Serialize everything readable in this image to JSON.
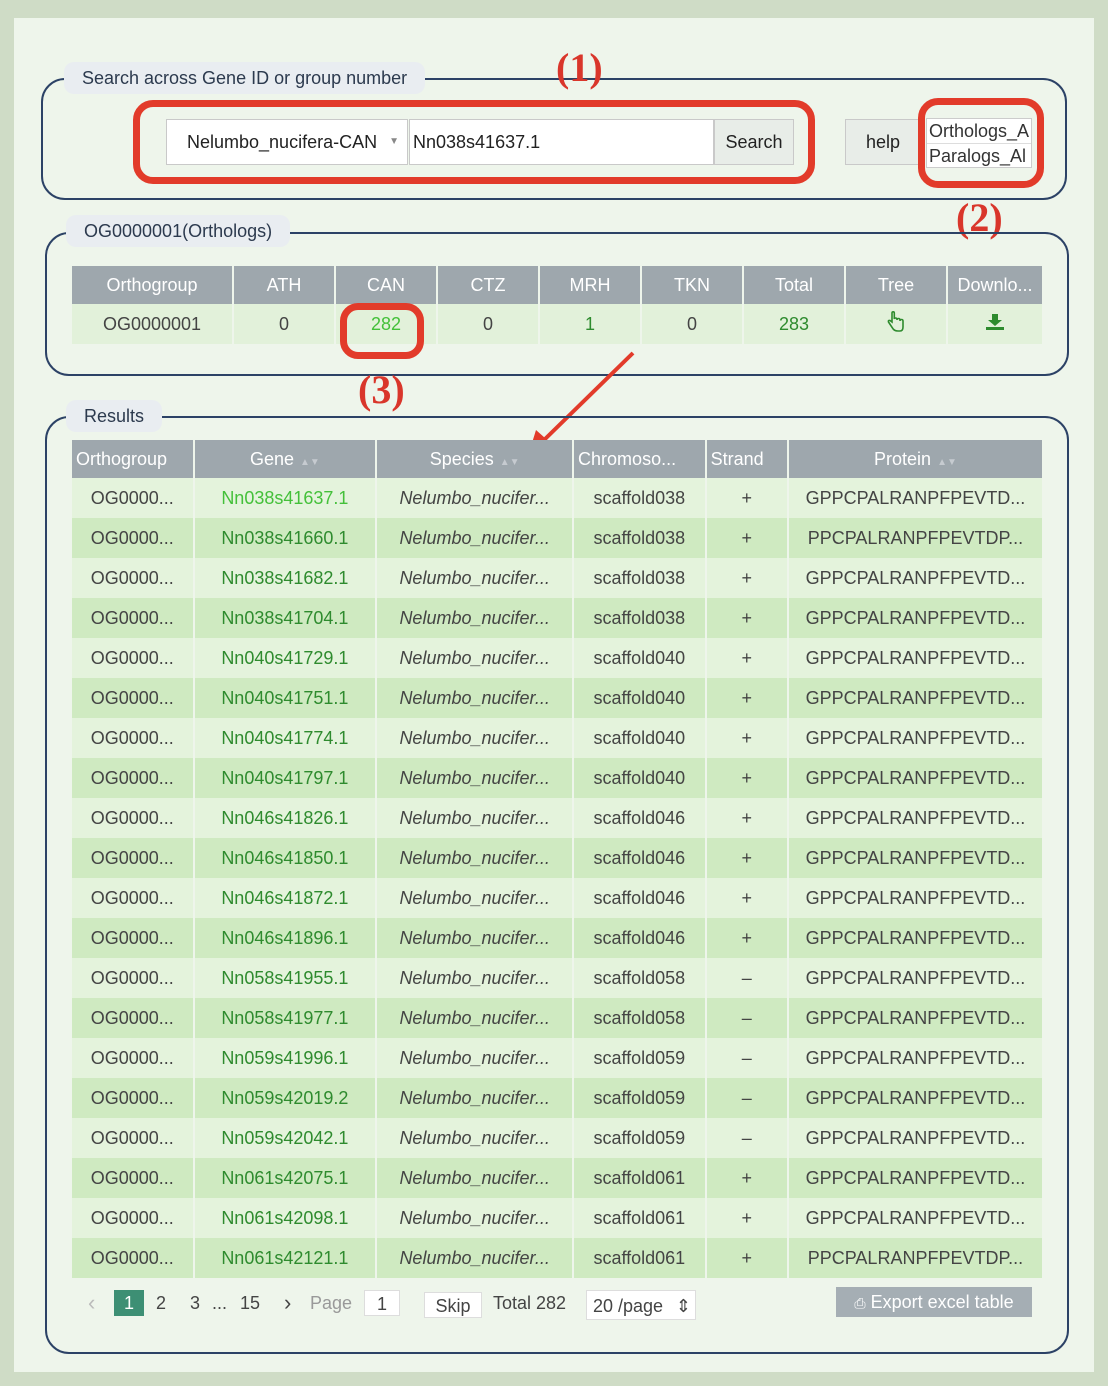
{
  "search": {
    "legend": "Search across Gene ID or group number",
    "species_select": "Nelumbo_nucifera-CAN",
    "query_value": "Nn038s41637.1",
    "search_button": "Search",
    "help_button": "help",
    "options": [
      "Orthologs_A",
      "Paralogs_Al"
    ]
  },
  "annotations": [
    "(1)",
    "(2)",
    "(3)"
  ],
  "orthogroup": {
    "legend": "OG0000001(Orthologs)",
    "headers": [
      "Orthogroup",
      "ATH",
      "CAN",
      "CTZ",
      "MRH",
      "TKN",
      "Total",
      "Tree",
      "Downlo..."
    ],
    "row": {
      "orthogroup": "OG0000001",
      "ATH": "0",
      "CAN": "282",
      "CTZ": "0",
      "MRH": "1",
      "TKN": "0",
      "Total": "283",
      "tree_icon": "pointing-hand-icon",
      "download_icon": "download-icon"
    }
  },
  "results": {
    "legend": "Results",
    "headers": [
      "Orthogroup",
      "Gene",
      "Species",
      "Chromoso...",
      "Strand",
      "Protein"
    ],
    "rows": [
      [
        "OG0000...",
        "Nn038s41637.1",
        "Nelumbo_nucifer...",
        "scaffold038",
        "+",
        "GPPCPALRANPFPEVTD..."
      ],
      [
        "OG0000...",
        "Nn038s41660.1",
        "Nelumbo_nucifer...",
        "scaffold038",
        "+",
        "PPCPALRANPFPEVTDP..."
      ],
      [
        "OG0000...",
        "Nn038s41682.1",
        "Nelumbo_nucifer...",
        "scaffold038",
        "+",
        "GPPCPALRANPFPEVTD..."
      ],
      [
        "OG0000...",
        "Nn038s41704.1",
        "Nelumbo_nucifer...",
        "scaffold038",
        "+",
        "GPPCPALRANPFPEVTD..."
      ],
      [
        "OG0000...",
        "Nn040s41729.1",
        "Nelumbo_nucifer...",
        "scaffold040",
        "+",
        "GPPCPALRANPFPEVTD..."
      ],
      [
        "OG0000...",
        "Nn040s41751.1",
        "Nelumbo_nucifer...",
        "scaffold040",
        "+",
        "GPPCPALRANPFPEVTD..."
      ],
      [
        "OG0000...",
        "Nn040s41774.1",
        "Nelumbo_nucifer...",
        "scaffold040",
        "+",
        "GPPCPALRANPFPEVTD..."
      ],
      [
        "OG0000...",
        "Nn040s41797.1",
        "Nelumbo_nucifer...",
        "scaffold040",
        "+",
        "GPPCPALRANPFPEVTD..."
      ],
      [
        "OG0000...",
        "Nn046s41826.1",
        "Nelumbo_nucifer...",
        "scaffold046",
        "+",
        "GPPCPALRANPFPEVTD..."
      ],
      [
        "OG0000...",
        "Nn046s41850.1",
        "Nelumbo_nucifer...",
        "scaffold046",
        "+",
        "GPPCPALRANPFPEVTD..."
      ],
      [
        "OG0000...",
        "Nn046s41872.1",
        "Nelumbo_nucifer...",
        "scaffold046",
        "+",
        "GPPCPALRANPFPEVTD..."
      ],
      [
        "OG0000...",
        "Nn046s41896.1",
        "Nelumbo_nucifer...",
        "scaffold046",
        "+",
        "GPPCPALRANPFPEVTD..."
      ],
      [
        "OG0000...",
        "Nn058s41955.1",
        "Nelumbo_nucifer...",
        "scaffold058",
        "–",
        "GPPCPALRANPFPEVTD..."
      ],
      [
        "OG0000...",
        "Nn058s41977.1",
        "Nelumbo_nucifer...",
        "scaffold058",
        "–",
        "GPPCPALRANPFPEVTD..."
      ],
      [
        "OG0000...",
        "Nn059s41996.1",
        "Nelumbo_nucifer...",
        "scaffold059",
        "–",
        "GPPCPALRANPFPEVTD..."
      ],
      [
        "OG0000...",
        "Nn059s42019.2",
        "Nelumbo_nucifer...",
        "scaffold059",
        "–",
        "GPPCPALRANPFPEVTD..."
      ],
      [
        "OG0000...",
        "Nn059s42042.1",
        "Nelumbo_nucifer...",
        "scaffold059",
        "–",
        "GPPCPALRANPFPEVTD..."
      ],
      [
        "OG0000...",
        "Nn061s42075.1",
        "Nelumbo_nucifer...",
        "scaffold061",
        "+",
        "GPPCPALRANPFPEVTD..."
      ],
      [
        "OG0000...",
        "Nn061s42098.1",
        "Nelumbo_nucifer...",
        "scaffold061",
        "+",
        "GPPCPALRANPFPEVTD..."
      ],
      [
        "OG0000...",
        "Nn061s42121.1",
        "Nelumbo_nucifer...",
        "scaffold061",
        "+",
        "PPCPALRANPFPEVTDP..."
      ]
    ]
  },
  "pagination": {
    "prev": "‹",
    "pages": [
      "1",
      "2",
      "3"
    ],
    "ellipsis": "...",
    "last_page": "15",
    "next": "›",
    "page_label": "Page",
    "page_input": "1",
    "skip": "Skip",
    "total": "Total 282",
    "page_size": "20 /page",
    "page_size_caret": "⇕",
    "export": "Export excel table"
  },
  "colors": {
    "highlight": "#e23b2a",
    "gene_link": "#2e8b2e",
    "header_bg": "#9ea7ad"
  }
}
